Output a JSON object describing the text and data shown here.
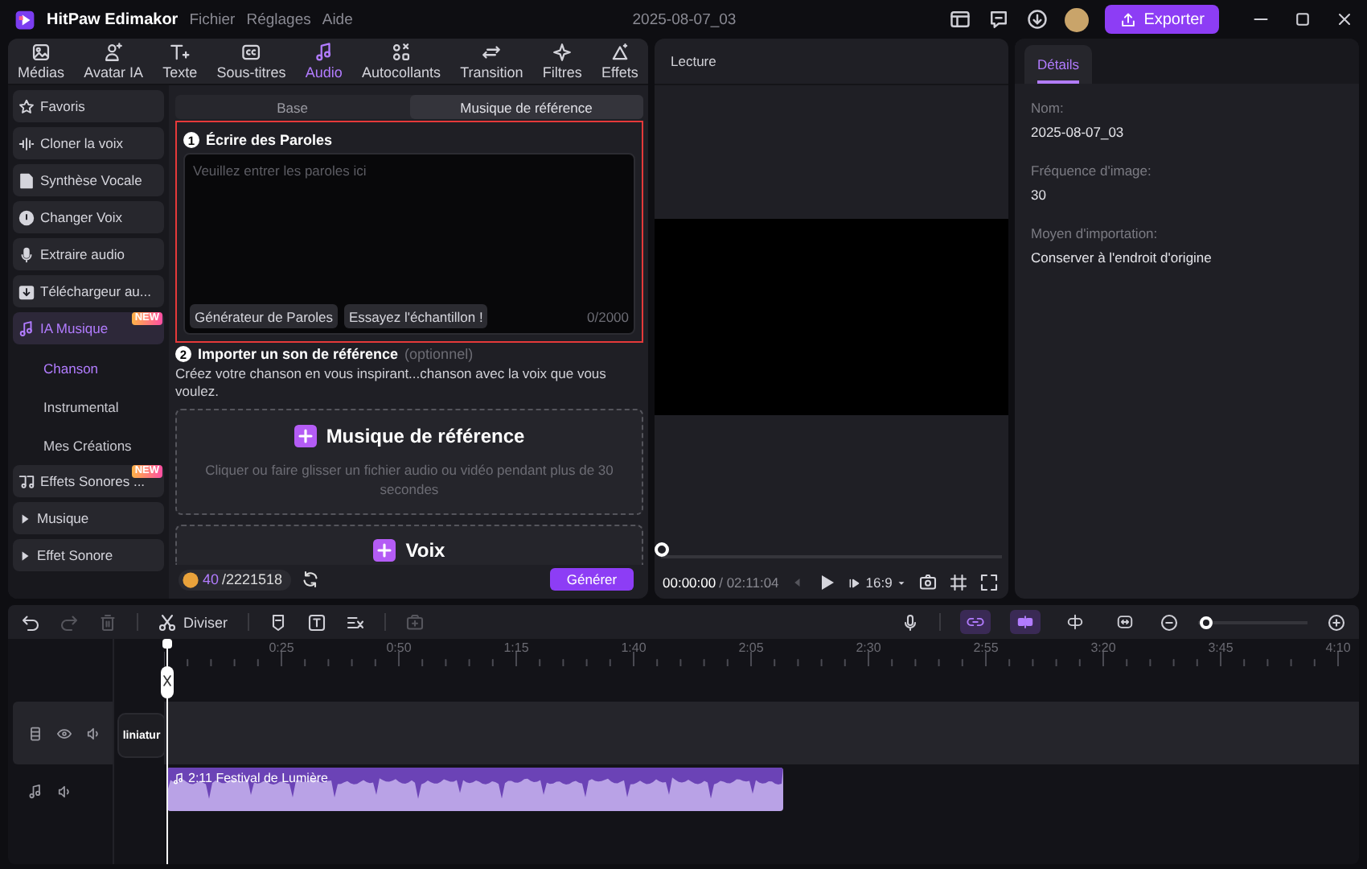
{
  "window": {
    "app_name": "HitPaw Edimakor",
    "menu": [
      "Fichier",
      "Réglages",
      "Aide"
    ],
    "project_name": "2025-08-07_03",
    "export_button": "Exporter"
  },
  "toolbar_tabs": [
    {
      "label": "Médias",
      "selected": false
    },
    {
      "label": "Avatar IA",
      "selected": false
    },
    {
      "label": "Texte",
      "selected": false
    },
    {
      "label": "Sous-titres",
      "selected": false
    },
    {
      "label": "Audio",
      "selected": true
    },
    {
      "label": "Autocollants",
      "selected": false
    },
    {
      "label": "Transition",
      "selected": false
    },
    {
      "label": "Filtres",
      "selected": false
    },
    {
      "label": "Effets",
      "selected": false
    }
  ],
  "sidebar": {
    "items": [
      {
        "kind": "item",
        "label": "Favoris",
        "selected": false
      },
      {
        "kind": "item",
        "label": "Cloner la voix",
        "selected": false
      },
      {
        "kind": "item",
        "label": "Synthèse Vocale",
        "selected": false
      },
      {
        "kind": "item",
        "label": "Changer Voix",
        "selected": false
      },
      {
        "kind": "item",
        "label": "Extraire audio",
        "selected": false
      },
      {
        "kind": "item",
        "label": "Téléchargeur au...",
        "selected": false
      },
      {
        "kind": "item",
        "label": "IA Musique",
        "selected": true,
        "badge": "NEW",
        "children": [
          {
            "label": "Chanson",
            "selected": true
          },
          {
            "label": "Instrumental",
            "selected": false
          },
          {
            "label": "Mes Créations",
            "selected": false
          }
        ]
      },
      {
        "kind": "item",
        "label": "Effets Sonores ...",
        "selected": false,
        "badge": "NEW"
      },
      {
        "kind": "folder",
        "label": "Musique",
        "expanded": false
      },
      {
        "kind": "folder",
        "label": "Effet Sonore",
        "expanded": false
      }
    ]
  },
  "sub_tabs": [
    {
      "label": "Base",
      "selected": false
    },
    {
      "label": "Musique de référence",
      "selected": true
    }
  ],
  "lyrics": {
    "step": "1",
    "title": "Écrire des Paroles",
    "placeholder": "Veuillez entrer les paroles ici",
    "buttons": [
      "Générateur de Paroles",
      "Essayez l'échantillon !"
    ],
    "counter": "0/2000",
    "highlighted": true
  },
  "reference": {
    "step": "2",
    "title": "Importer un son de référence",
    "optional": "(optionnel)",
    "description": "Créez votre chanson en vous inspirant...chanson avec la voix que vous voulez.",
    "drop_zones": [
      {
        "title": "Musique de référence",
        "hint": "Cliquer ou faire glisser un fichier audio ou vidéo pendant plus de 30 secondes"
      },
      {
        "title": "Voix"
      }
    ]
  },
  "footer": {
    "credits_used": "40",
    "credits_total": "/2221518",
    "generate_button": "Générer"
  },
  "preview": {
    "title": "Lecture",
    "current_time": "00:00:00",
    "total_time": "/ 02:11:04",
    "aspect_ratio": "16:9",
    "level": 0
  },
  "details": {
    "tab": "Détails",
    "fields": [
      {
        "label": "Nom:",
        "value": "2025-08-07_03"
      },
      {
        "label": "Fréquence d'image:",
        "value": "30"
      },
      {
        "label": "Moyen d'importation:",
        "value": "Conserver à l'endroit d'origine"
      }
    ]
  },
  "timeline": {
    "split_button": "Diviser",
    "toggles": [
      {
        "on": true
      },
      {
        "on": true
      },
      {
        "on": false
      },
      {
        "on": false
      }
    ],
    "zoom": {
      "level": 0.02
    },
    "ruler": [
      "0:25",
      "0:50",
      "1:15",
      "1:40",
      "2:05",
      "2:30",
      "2:55",
      "3:20",
      "3:45",
      "4:10"
    ],
    "thumbnail_label": "liniatur",
    "clip": {
      "title": "2:11 Festival de Lumière"
    }
  }
}
